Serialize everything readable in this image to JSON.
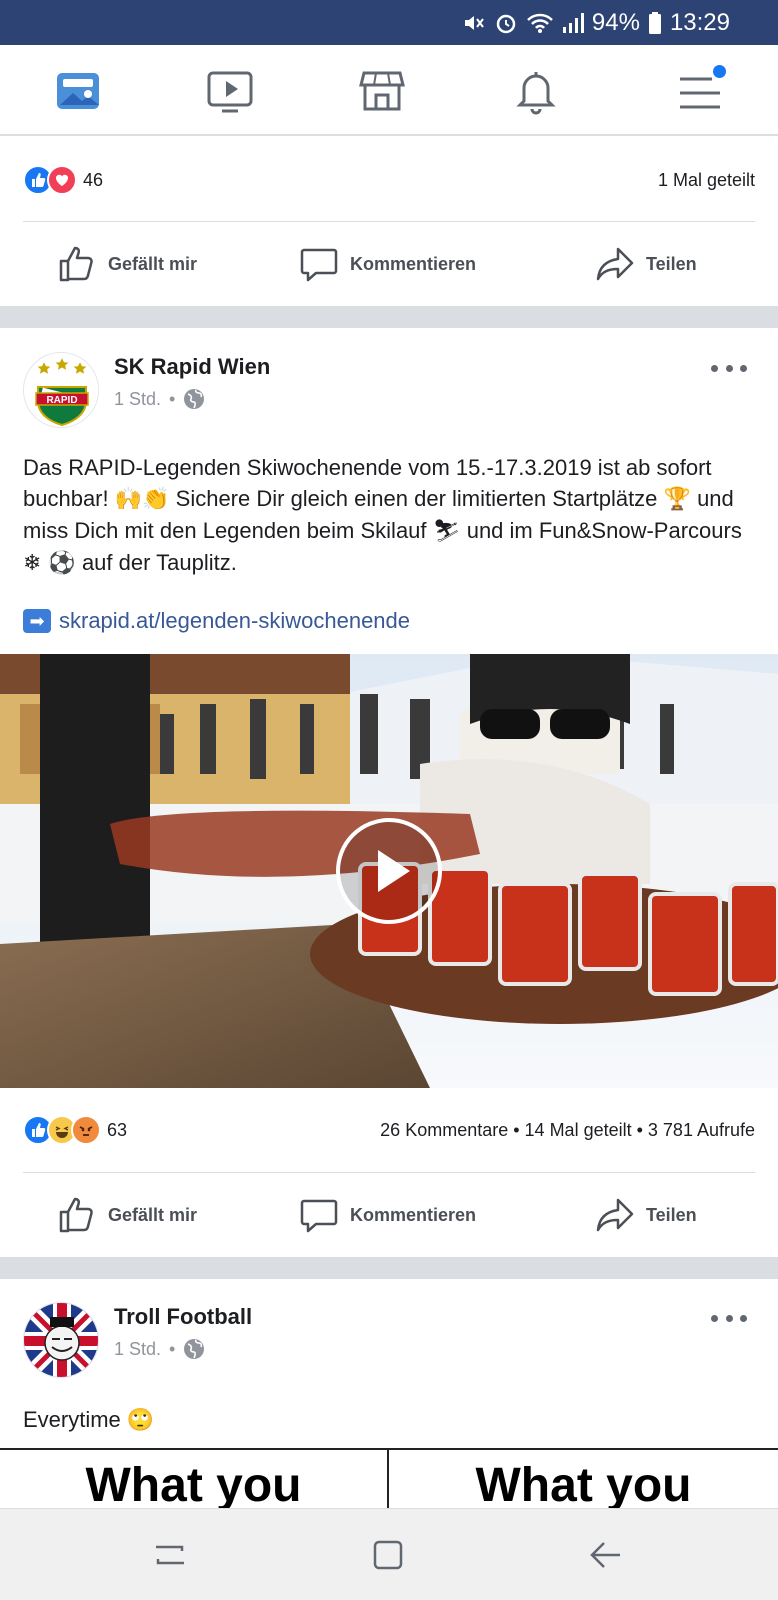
{
  "status_bar": {
    "battery": "94%",
    "time": "13:29"
  },
  "top_nav": {
    "icons": [
      "news-feed-icon",
      "watch-icon",
      "marketplace-icon",
      "notifications-icon",
      "menu-icon"
    ]
  },
  "post1": {
    "reaction_count": "46",
    "shares": "1 Mal geteilt"
  },
  "actions": {
    "like": "Gefällt mir",
    "comment": "Kommentieren",
    "share": "Teilen"
  },
  "post2": {
    "page_name": "SK Rapid Wien",
    "time": "1 Std.",
    "text_1": "Das RAPID-Legenden Skiwochenende vom 15.-17.3.2019 ist ab sofort buchbar! ",
    "text_2": " Sichere Dir gleich einen der limitierten Startplätze ",
    "text_3": " und miss Dich mit den Legenden beim Skilauf ",
    "text_4": " und im Fun&Snow-Parcours ",
    "text_5": " auf der Tauplitz.",
    "emoji_hands": "🙌👏",
    "emoji_trophy": "🏆",
    "emoji_ski": "⛷",
    "emoji_snow_ball": "❄ ⚽",
    "link_arrow": "➡",
    "link": "skrapid.at/legenden-skiwochenende",
    "reaction_count": "63",
    "stats": "26 Kommentare • 14 Mal geteilt • 3 781 Aufrufe"
  },
  "post3": {
    "page_name": "Troll Football",
    "time": "1 Std.",
    "text": "Everytime",
    "emoji": "🙄",
    "meme_left": "What you",
    "meme_right": "What you"
  },
  "colors": {
    "brand": "#2d4373",
    "accent": "#1877f2",
    "link": "#385898"
  }
}
